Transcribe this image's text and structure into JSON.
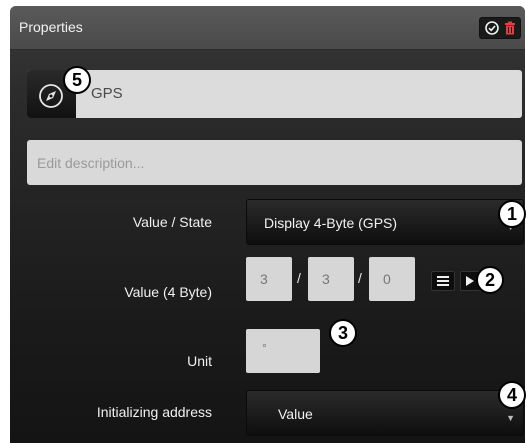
{
  "panel": {
    "title": "Properties"
  },
  "header_buttons": {
    "confirm_icon": "check-circle-icon",
    "delete_icon": "trash-icon"
  },
  "name_row": {
    "icon": "compass-icon",
    "value": "GPS"
  },
  "description": {
    "placeholder": "Edit description..."
  },
  "value_state": {
    "label": "Value / State",
    "selected": "Display 4-Byte (GPS)"
  },
  "value_4byte": {
    "label": "Value (4 Byte)",
    "bytes": [
      "3",
      "3",
      "0"
    ],
    "separator": "/",
    "list_icon": "list-icon",
    "arrow_icon": "arrow-right-icon"
  },
  "unit": {
    "label": "Unit",
    "value": "°"
  },
  "init_address": {
    "label": "Initializing address",
    "selected": "Value"
  },
  "callouts": [
    "1",
    "2",
    "3",
    "4",
    "5"
  ],
  "colors": {
    "panel_bg": "#1b1b1b",
    "header_bg": "#4e4e4e",
    "input_bg": "#d9d9d9",
    "text_light": "#f0f0f0"
  }
}
